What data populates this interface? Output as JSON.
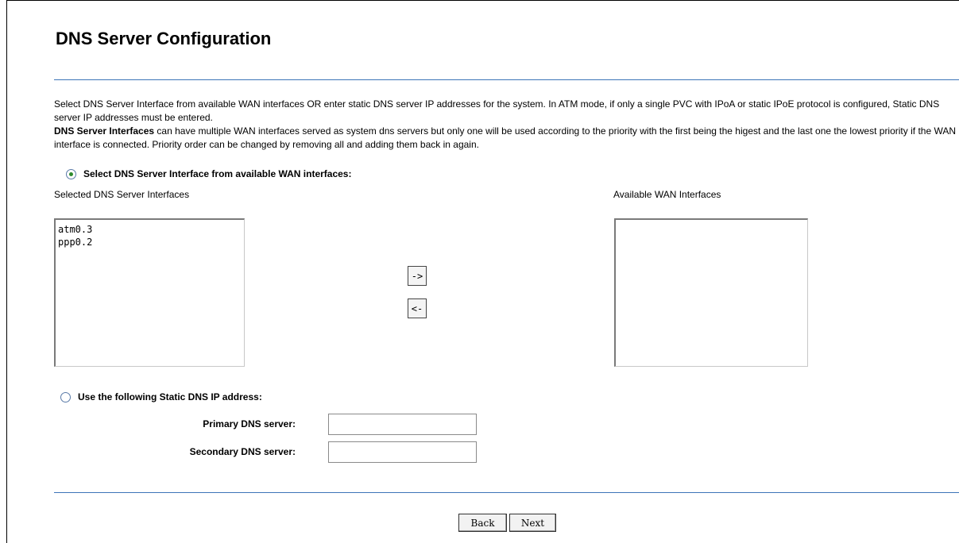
{
  "page": {
    "title": "DNS Server Configuration"
  },
  "description": {
    "line1": "Select DNS Server Interface from available WAN interfaces OR enter static DNS server IP addresses for the system. In ATM mode, if only a single PVC with IPoA or static IPoE protocol is configured, Static DNS server IP addresses must be entered.",
    "bold_term": "DNS Server Interfaces",
    "line2_rest": " can have multiple WAN interfaces served as system dns servers but only one will be used according to the priority with the first being the higest and the last one the lowest priority if the WAN interface is connected. Priority order can be changed by removing all and adding them back in again."
  },
  "interface_mode": {
    "label": "Select DNS Server Interface from available WAN interfaces:",
    "selected": true,
    "selected_list_label": "Selected DNS Server Interfaces",
    "selected_items": [
      "atm0.3",
      "ppp0.2"
    ],
    "available_list_label": "Available WAN Interfaces",
    "available_items": [],
    "add_button_label": "->",
    "remove_button_label": "<-"
  },
  "static_mode": {
    "label": "Use the following Static DNS IP address:",
    "selected": false,
    "primary_label": "Primary DNS server:",
    "primary_value": "",
    "secondary_label": "Secondary DNS server:",
    "secondary_value": ""
  },
  "navigation": {
    "back_label": "Back",
    "next_label": "Next"
  },
  "colors": {
    "rule": "#3c74b8",
    "radio_dot": "#2e8b2e"
  }
}
